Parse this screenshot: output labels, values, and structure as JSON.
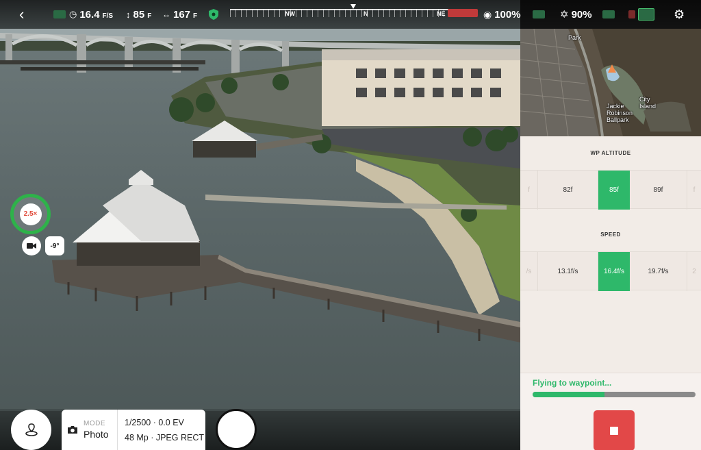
{
  "topbar": {
    "speed_value": "16.4",
    "speed_unit": "F/S",
    "altitude_value": "85",
    "altitude_unit": "F",
    "distance_value": "167",
    "distance_unit": "F",
    "compass_labels": [
      "NW",
      "N",
      "NE"
    ],
    "controller_battery": "100%",
    "drone_battery": "90%"
  },
  "overlay": {
    "zoom": "2.5×",
    "gimbal_tilt": "-9°"
  },
  "camera": {
    "mode_label": "MODE",
    "mode_value": "Photo",
    "exposure": "1/2500 · 0.0 EV",
    "format": "48 Mp · JPEG RECT"
  },
  "map": {
    "labels": [
      "Park",
      "Jackie Robinson Ballpark",
      "City Island"
    ]
  },
  "waypoint": {
    "altitude_title": "WP ALTITUDE",
    "altitude_options": [
      "f",
      "82f",
      "85f",
      "89f",
      "f"
    ],
    "speed_title": "SPEED",
    "speed_options": [
      "/s",
      "13.1f/s",
      "16.4f/s",
      "19.7f/s",
      "2"
    ]
  },
  "status": {
    "text": "Flying to waypoint...",
    "progress": 0.44
  },
  "colors": {
    "accent_green": "#2eb86a",
    "stop_red": "#e24848"
  },
  "icons": [
    "back-icon",
    "speed-icon",
    "altitude-icon",
    "distance-icon",
    "shield-icon",
    "controller-icon",
    "propeller-icon",
    "settings-icon",
    "video-camera-icon",
    "map-pin-icon",
    "photo-camera-icon",
    "stop-icon"
  ]
}
